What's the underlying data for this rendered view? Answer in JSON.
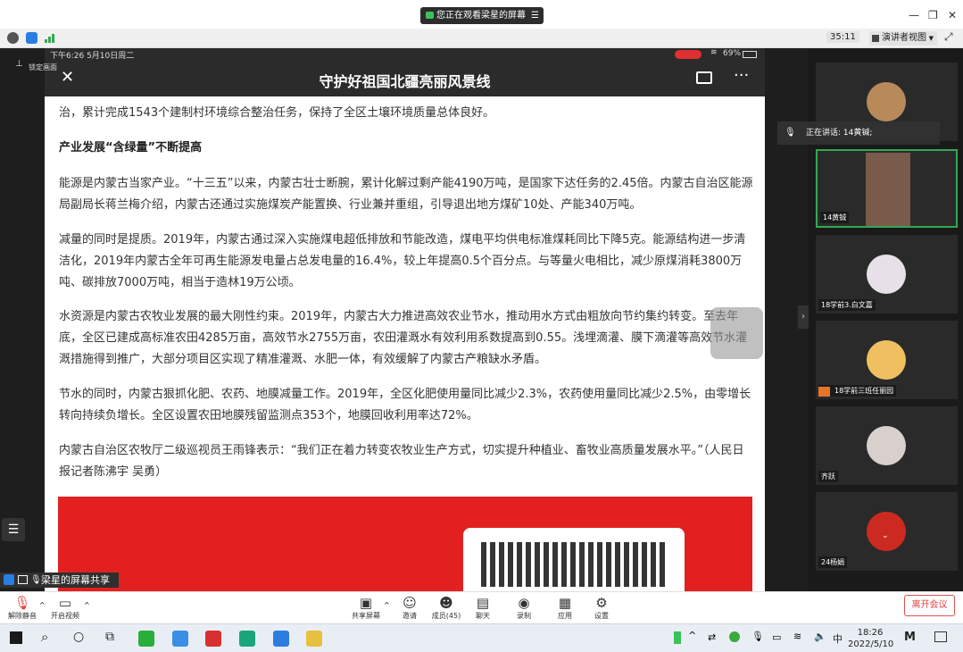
{
  "window": {
    "share_banner": "您正在观看梁星的屏幕",
    "minimize": "—",
    "restore": "❐",
    "close": "✕"
  },
  "toolbar2": {
    "timer": "35:11",
    "view_mode": "演讲者视图"
  },
  "phone": {
    "status_time": "下午6:26  5月10日周二",
    "battery": "69%",
    "nav_title": "守护好祖国北疆亮丽风景线"
  },
  "article": {
    "paragraphs": [
      "治，累计完成1543个建制村环境综合整治任务，保持了全区土壤环境质量总体良好。",
      "产业发展“含绿量”不断提高",
      "能源是内蒙古当家产业。“十三五”以来，内蒙古壮士断腕，累计化解过剩产能4190万吨，是国家下达任务的2.45倍。内蒙古自治区能源局副局长蒋兰梅介绍，内蒙古还通过实施煤炭产能置换、行业兼并重组，引导退出地方煤矿10处、产能340万吨。",
      "减量的同时是提质。2019年，内蒙古通过深入实施煤电超低排放和节能改造，煤电平均供电标准煤耗同比下降5克。能源结构进一步清洁化，2019年内蒙古全年可再生能源发电量占总发电量的16.4%，较上年提高0.5个百分点。与等量火电相比，减少原煤消耗3800万吨、碳排放7000万吨，相当于造林19万公顷。",
      "水资源是内蒙古农牧业发展的最大刚性约束。2019年，内蒙古大力推进高效农业节水，推动用水方式由粗放向节约集约转变。至去年底，全区已建成高标准农田4285万亩，高效节水2755万亩，农田灌溉水有效利用系数提高到0.55。浅埋滴灌、膜下滴灌等高效节水灌溉措施得到推广，大部分项目区实现了精准灌溉、水肥一体，有效缓解了内蒙古产粮缺水矛盾。",
      "节水的同时，内蒙古狠抓化肥、农药、地膜减量工作。2019年，全区化肥使用量同比减少2.3%，农药使用量同比减少2.5%，由零增长转向持续负增长。全区设置农田地膜残留监测点353个，地膜回收利用率达72%。",
      "内蒙古自治区农牧厅二级巡视员王雨锋表示：“我们正在着力转变农牧业生产方式，切实提升种植业、畜牧业高质量发展水平。”（人民日报记者陈沸宇 吴勇）"
    ]
  },
  "overlay": {
    "lock_label": "锁定画面",
    "share_tag": "梁星的屏幕共享",
    "speaking": "正在讲话: 14黄铖;"
  },
  "participants": [
    {
      "name": "",
      "color": "#b88a5a"
    },
    {
      "name": "14黄铖",
      "color": "#7a5a4a"
    },
    {
      "name": "18学前3.白文嘉",
      "color": "#e8e0e8"
    },
    {
      "name": "18学前三班任丽园",
      "color": "#f0c060"
    },
    {
      "name": "齐跃",
      "color": "#d8d0cc"
    },
    {
      "name": "24杨娟",
      "color": "#cc2a20"
    }
  ],
  "controls": {
    "unmute": "解除静音",
    "start_video": "开启视频",
    "share_screen": "共享屏幕",
    "invite": "邀请",
    "members": "成员(45)",
    "chat": "聊天",
    "record": "录制",
    "apps": "应用",
    "settings": "设置",
    "leave": "离开会议"
  },
  "taskbar": {
    "ime": "中",
    "time": "18:26",
    "date": "2022/5/10"
  },
  "colors": {
    "accent_green": "#32a852",
    "leave_red": "#e04040",
    "article_red": "#e32020"
  }
}
